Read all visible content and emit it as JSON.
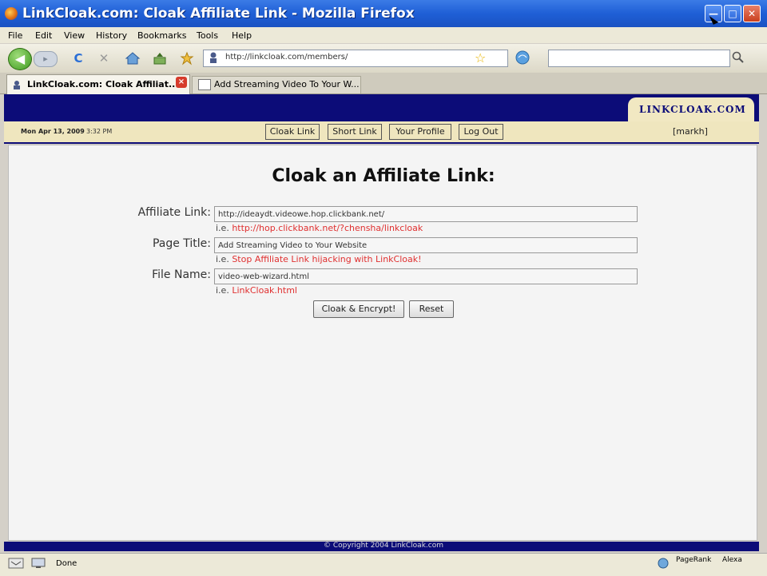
{
  "window": {
    "title": "LinkCloak.com: Cloak Affiliate Link - Mozilla Firefox",
    "min": "—",
    "max": "□",
    "close": "✕"
  },
  "menu": [
    "File",
    "Edit",
    "View",
    "History",
    "Bookmarks",
    "Tools",
    "Help"
  ],
  "toolbar": {
    "url": "http://linkcloak.com/members/",
    "back_icon": "◀",
    "forward_icon": "▸",
    "reload_icon": "C",
    "stop_icon": "✕",
    "star_icon": "☆"
  },
  "tabs": [
    {
      "label": "LinkCloak.com: Cloak Affiliat...",
      "close": "×"
    },
    {
      "label": "Add Streaming Video To Your W..."
    }
  ],
  "page": {
    "logo": "LINKCLOAK.COM",
    "date": "Mon Apr 13, 2009",
    "time": "3:32 PM",
    "nav": [
      "Cloak Link",
      "Short Link",
      "Your Profile",
      "Log Out"
    ],
    "user": "[markh]",
    "heading": "Cloak an Affiliate Link:",
    "fields": [
      {
        "label": "Affiliate Link:",
        "value": "http://ideaydt.videowe.hop.clickbank.net/",
        "hint_prefix": "i.e.",
        "hint": "http://hop.clickbank.net/?chensha/linkcloak"
      },
      {
        "label": "Page Title:",
        "value": "Add Streaming Video to Your Website",
        "hint_prefix": "i.e.",
        "hint": "Stop Affiliate Link hijacking with LinkCloak!"
      },
      {
        "label": "File Name:",
        "value": "video-web-wizard.html",
        "hint_prefix": "i.e.",
        "hint": "LinkCloak.html"
      }
    ],
    "submit": "Cloak & Encrypt!",
    "reset": "Reset",
    "footer": "© Copyright 2004 LinkCloak.com"
  },
  "status": {
    "text": "Done",
    "right1": "PageRank",
    "right2": "Alexa"
  }
}
